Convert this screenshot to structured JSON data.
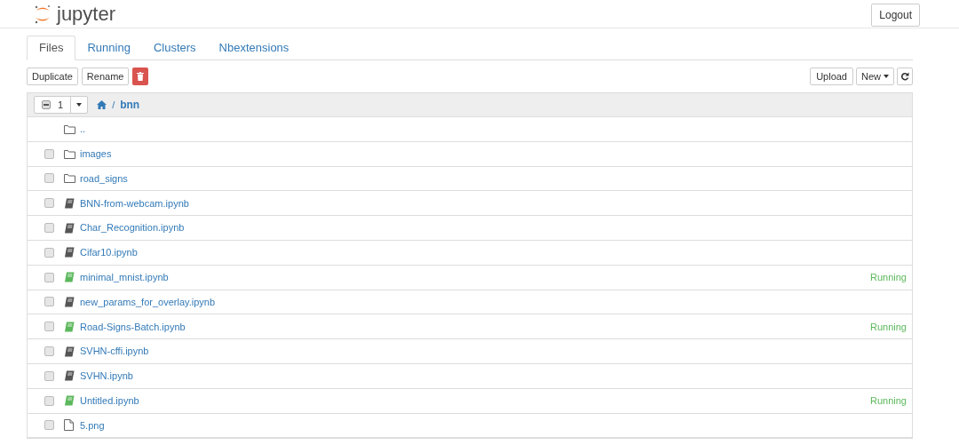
{
  "header": {
    "logo_text": "jupyter",
    "logout_button": "Logout"
  },
  "tabs": [
    {
      "label": "Files",
      "selected": true
    },
    {
      "label": "Running",
      "selected": false
    },
    {
      "label": "Clusters",
      "selected": false
    },
    {
      "label": "Nbextensions",
      "selected": false
    }
  ],
  "toolbar": {
    "left_buttons": [
      "Duplicate",
      "Rename"
    ],
    "upload_button": "Upload",
    "new_button": "New"
  },
  "list_header": {
    "select_all_indeterminate": true,
    "selected_count": "1",
    "breadcrumb_separator": "/",
    "folder": "bnn"
  },
  "files": [
    {
      "kind": "parent",
      "name": ".."
    },
    {
      "kind": "folder",
      "name": "images",
      "checked": false
    },
    {
      "kind": "folder",
      "name": "road_signs",
      "checked": false
    },
    {
      "kind": "notebook",
      "name": "BNN-from-webcam.ipynb",
      "checked": false,
      "running": false
    },
    {
      "kind": "notebook",
      "name": "Char_Recognition.ipynb",
      "checked": false,
      "running": false
    },
    {
      "kind": "notebook",
      "name": "Cifar10.ipynb",
      "checked": false,
      "running": false
    },
    {
      "kind": "notebook",
      "name": "minimal_mnist.ipynb",
      "checked": false,
      "running": true,
      "status": "Running"
    },
    {
      "kind": "notebook",
      "name": "new_params_for_overlay.ipynb",
      "checked": false,
      "running": false
    },
    {
      "kind": "notebook",
      "name": "Road-Signs-Batch.ipynb",
      "checked": false,
      "running": true,
      "status": "Running"
    },
    {
      "kind": "notebook",
      "name": "SVHN-cffi.ipynb",
      "checked": false,
      "running": false
    },
    {
      "kind": "notebook",
      "name": "SVHN.ipynb",
      "checked": false,
      "running": false
    },
    {
      "kind": "notebook",
      "name": "Untitled.ipynb",
      "checked": false,
      "running": true,
      "status": "Running"
    },
    {
      "kind": "file",
      "name": "5.png",
      "checked": false
    }
  ]
}
